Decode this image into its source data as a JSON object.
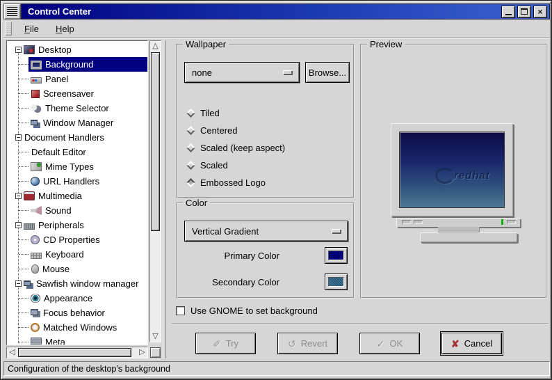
{
  "window": {
    "title": "Control Center",
    "close_glyph": "×"
  },
  "menubar": {
    "items": [
      {
        "label": "File"
      },
      {
        "label": "Help"
      }
    ]
  },
  "icons": {
    "scroll_up": "△",
    "scroll_down": "▽",
    "scroll_left": "◁",
    "scroll_right": "▷"
  },
  "tree": {
    "items": [
      {
        "label": "Desktop",
        "level": 0,
        "expander": true,
        "icon": "desktop-icon",
        "selected": false
      },
      {
        "label": "Background",
        "level": 1,
        "icon": "background-monitor-icon",
        "selected": true
      },
      {
        "label": "Panel",
        "level": 1,
        "icon": "panel-icon",
        "selected": false
      },
      {
        "label": "Screensaver",
        "level": 1,
        "icon": "screensaver-icon",
        "selected": false
      },
      {
        "label": "Theme Selector",
        "level": 1,
        "icon": "theme-selector-icon",
        "selected": false
      },
      {
        "label": "Window Manager",
        "level": 1,
        "icon": "window-manager-icon",
        "selected": false
      },
      {
        "label": "Document Handlers",
        "level": 0,
        "expander": true,
        "icon": null,
        "selected": false
      },
      {
        "label": "Default Editor",
        "level": 1,
        "icon": null,
        "selected": false
      },
      {
        "label": "Mime Types",
        "level": 1,
        "icon": "mime-types-icon",
        "selected": false
      },
      {
        "label": "URL Handlers",
        "level": 1,
        "icon": "url-handlers-globe-icon",
        "selected": false
      },
      {
        "label": "Multimedia",
        "level": 0,
        "expander": true,
        "icon": "multimedia-drum-icon",
        "selected": false
      },
      {
        "label": "Sound",
        "level": 1,
        "icon": "sound-speaker-icon",
        "selected": false
      },
      {
        "label": "Peripherals",
        "level": 0,
        "expander": true,
        "icon": "peripherals-chip-icon",
        "selected": false
      },
      {
        "label": "CD Properties",
        "level": 1,
        "icon": "cd-disc-icon",
        "selected": false
      },
      {
        "label": "Keyboard",
        "level": 1,
        "icon": "keyboard-icon",
        "selected": false
      },
      {
        "label": "Mouse",
        "level": 1,
        "icon": "mouse-icon",
        "selected": false
      },
      {
        "label": "Sawfish window manager",
        "level": 0,
        "expander": true,
        "icon": "sawfish-windows-icon",
        "selected": false
      },
      {
        "label": "Appearance",
        "level": 1,
        "icon": "appearance-eye-icon",
        "selected": false
      },
      {
        "label": "Focus behavior",
        "level": 1,
        "icon": "focus-behavior-icon",
        "selected": false
      },
      {
        "label": "Matched Windows",
        "level": 1,
        "icon": "matched-windows-icon",
        "selected": false
      },
      {
        "label": "Meta",
        "level": 1,
        "icon": "meta-icon",
        "selected": false
      }
    ]
  },
  "wallpaper": {
    "legend": "Wallpaper",
    "dropdown_value": "none",
    "browse_label": "Browse...",
    "radios": [
      {
        "label": "Tiled",
        "selected": false
      },
      {
        "label": "Centered",
        "selected": false
      },
      {
        "label": "Scaled (keep aspect)",
        "selected": false
      },
      {
        "label": "Scaled",
        "selected": false
      },
      {
        "label": "Embossed Logo",
        "selected": true
      }
    ]
  },
  "color": {
    "legend": "Color",
    "dropdown_value": "Vertical Gradient",
    "primary_label": "Primary Color",
    "secondary_label": "Secondary Color",
    "primary_hex": "#000072",
    "secondary_hex": "#2f6a8f"
  },
  "preview": {
    "legend": "Preview",
    "logo_text": "redhat"
  },
  "gnome_checkbox": {
    "label": "Use GNOME to set background",
    "checked": false
  },
  "actions": [
    {
      "label": "Try",
      "icon_glyph": "✐",
      "enabled": false
    },
    {
      "label": "Revert",
      "icon_glyph": "↺",
      "enabled": false
    },
    {
      "label": "OK",
      "icon_glyph": "✓",
      "enabled": false
    },
    {
      "label": "Cancel",
      "icon_glyph": "✘",
      "enabled": true
    }
  ],
  "statusbar": {
    "text": "Configuration of the desktop’s background"
  }
}
